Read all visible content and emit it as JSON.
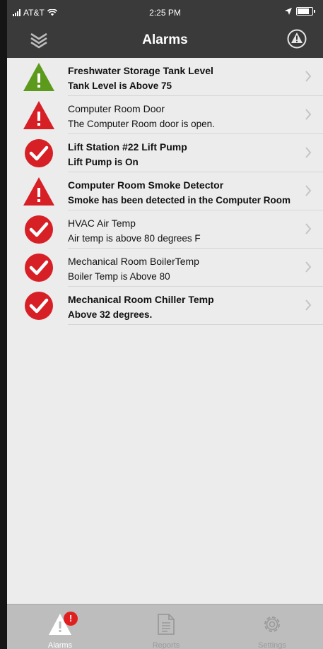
{
  "status_bar": {
    "carrier": "AT&T",
    "time": "2:25 PM"
  },
  "navbar": {
    "title": "Alarms"
  },
  "alarms": [
    {
      "title": "Freshwater Storage Tank Level",
      "subtitle": "Tank Level is Above 75",
      "status_icon": "warning-green-icon",
      "bold": true
    },
    {
      "title": "Computer Room Door",
      "subtitle": "The Computer Room door is open.",
      "status_icon": "warning-red-icon",
      "bold": false
    },
    {
      "title": "Lift Station #22 Lift Pump",
      "subtitle": "Lift Pump is On",
      "status_icon": "check-red-icon",
      "bold": true
    },
    {
      "title": "Computer Room Smoke Detector",
      "subtitle": "Smoke has been detected in the Computer Room",
      "status_icon": "warning-red-icon",
      "bold": true
    },
    {
      "title": "HVAC Air Temp",
      "subtitle": "Air temp is above 80 degrees F",
      "status_icon": "check-red-icon",
      "bold": false
    },
    {
      "title": "Mechanical Room BoilerTemp",
      "subtitle": "Boiler Temp is Above 80",
      "status_icon": "check-red-icon",
      "bold": false
    },
    {
      "title": "Mechanical Room Chiller Temp",
      "subtitle": "Above 32 degrees.",
      "status_icon": "check-red-icon",
      "bold": true
    }
  ],
  "tabbar": {
    "badge": "!",
    "tabs": [
      {
        "label": "Alarms"
      },
      {
        "label": "Reports"
      },
      {
        "label": "Settings"
      }
    ]
  },
  "colors": {
    "alarm_red": "#d71f26",
    "warning_green": "#5b9a1a",
    "bar_dark": "#3a3a3a",
    "list_bg": "#ececec"
  }
}
